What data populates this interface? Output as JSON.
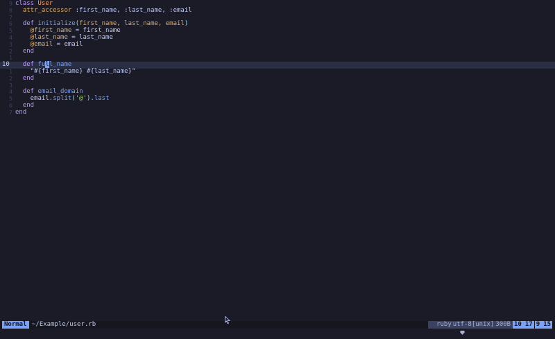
{
  "editor": {
    "lines": [
      {
        "gutter": "9",
        "current": false,
        "tokens": [
          {
            "t": "class ",
            "c": "keyword"
          },
          {
            "t": "User",
            "c": "class"
          }
        ]
      },
      {
        "gutter": "8",
        "current": false,
        "tokens": [
          {
            "t": "  attr_accessor ",
            "c": "param"
          },
          {
            "t": ":first_name, :last_name, :email",
            "c": "symbol"
          }
        ]
      },
      {
        "gutter": "7",
        "current": false,
        "tokens": []
      },
      {
        "gutter": "6",
        "current": false,
        "tokens": [
          {
            "t": "  def ",
            "c": "keyword"
          },
          {
            "t": "initialize",
            "c": "method"
          },
          {
            "t": "(",
            "c": "punct"
          },
          {
            "t": "first_name, last_name, email",
            "c": "param"
          },
          {
            "t": ")",
            "c": "punct"
          }
        ]
      },
      {
        "gutter": "5",
        "current": false,
        "tokens": [
          {
            "t": "    @first_name",
            "c": "param"
          },
          {
            "t": " = first_name",
            "c": "plain"
          }
        ]
      },
      {
        "gutter": "4",
        "current": false,
        "tokens": [
          {
            "t": "    @last_name",
            "c": "param"
          },
          {
            "t": " = last_name",
            "c": "plain"
          }
        ]
      },
      {
        "gutter": "3",
        "current": false,
        "tokens": [
          {
            "t": "    @email",
            "c": "param"
          },
          {
            "t": " = email",
            "c": "plain"
          }
        ]
      },
      {
        "gutter": "2",
        "current": false,
        "tokens": [
          {
            "t": "  end",
            "c": "keyword"
          }
        ]
      },
      {
        "gutter": "1",
        "current": false,
        "tokens": []
      },
      {
        "gutter": "10",
        "current": true,
        "tokens": [
          {
            "t": "  def ",
            "c": "keyword"
          },
          {
            "t": "fu",
            "c": "method"
          },
          {
            "t": "l",
            "c": "cursor"
          },
          {
            "t": "l_name",
            "c": "method"
          }
        ]
      },
      {
        "gutter": "1",
        "current": false,
        "tokens": [
          {
            "t": "    \"#{first_name} #{last_name}\"",
            "c": "string"
          }
        ]
      },
      {
        "gutter": "2",
        "current": false,
        "tokens": [
          {
            "t": "  end",
            "c": "keyword"
          }
        ]
      },
      {
        "gutter": "3",
        "current": false,
        "tokens": []
      },
      {
        "gutter": "4",
        "current": false,
        "tokens": [
          {
            "t": "  def ",
            "c": "keyword"
          },
          {
            "t": "email_domain",
            "c": "method"
          }
        ]
      },
      {
        "gutter": "5",
        "current": false,
        "tokens": [
          {
            "t": "    email",
            "c": "plain"
          },
          {
            "t": ".",
            "c": "punct"
          },
          {
            "t": "split",
            "c": "method"
          },
          {
            "t": "(",
            "c": "punct"
          },
          {
            "t": "'@'",
            "c": "string-lit"
          },
          {
            "t": ")",
            "c": "punct"
          },
          {
            "t": ".",
            "c": "punct"
          },
          {
            "t": "last",
            "c": "method"
          }
        ]
      },
      {
        "gutter": "6",
        "current": false,
        "tokens": [
          {
            "t": "  end",
            "c": "keyword"
          }
        ]
      },
      {
        "gutter": "7",
        "current": false,
        "tokens": [
          {
            "t": "end",
            "c": "keyword"
          }
        ]
      }
    ]
  },
  "statusbar": {
    "mode": "Normal",
    "filepath": "~/Example/user.rb",
    "filetype": "ruby",
    "encoding": "utf-8[unix]",
    "filesize": "300B",
    "line": "10",
    "line_total": "17",
    "column": "9",
    "column_total": "15"
  },
  "colors": {
    "background": "#1a1b26",
    "accent": "#7aa2f7",
    "keyword": "#bb9af7",
    "class": "#ff9e64",
    "param": "#e0af68",
    "string_literal": "#9ece6a"
  }
}
